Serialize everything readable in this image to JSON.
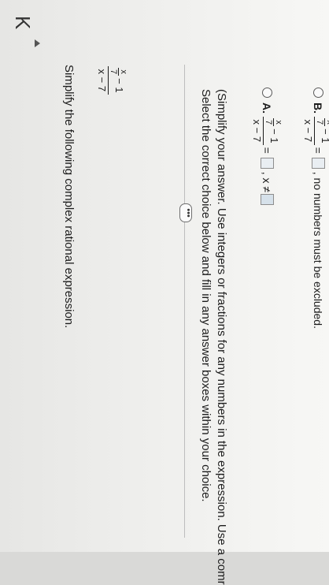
{
  "nav": {
    "back_icon": "⇤",
    "back_label": "K"
  },
  "question": {
    "prompt": "Simplify the following complex rational expression."
  },
  "expression": {
    "inner_num": "x",
    "inner_den": "7",
    "minus_one": "− 1",
    "outer_den": "x − 7"
  },
  "more_button": {
    "label": "•••"
  },
  "instructions": {
    "line1": "Select the correct choice below and fill in any answer boxes within your choice.",
    "line2": "(Simplify your answer. Use integers or fractions for any numbers in the expression. Use a comr"
  },
  "choices": {
    "a": {
      "label": "A.",
      "equals": "=",
      "suffix": ", x ≠"
    },
    "b": {
      "label": "B.",
      "equals": "=",
      "suffix": ", no numbers must be excluded."
    }
  }
}
